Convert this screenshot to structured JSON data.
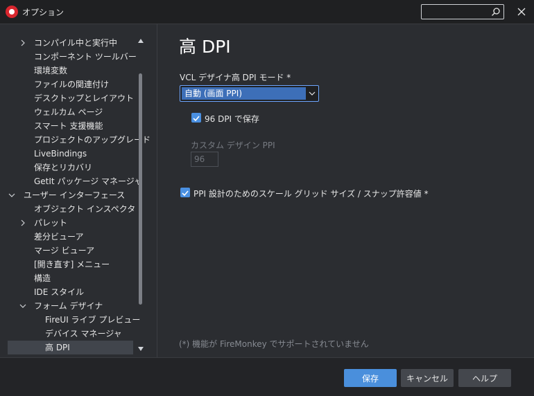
{
  "window": {
    "title": "オプション",
    "search_placeholder": ""
  },
  "sidebar": {
    "items": [
      {
        "label": "コンパイル中と実行中",
        "level": 1,
        "expander": "collapsed"
      },
      {
        "label": "コンポーネント ツールバー",
        "level": 1,
        "expander": "none"
      },
      {
        "label": "環境変数",
        "level": 1,
        "expander": "none"
      },
      {
        "label": "ファイルの関連付け",
        "level": 1,
        "expander": "none"
      },
      {
        "label": "デスクトップとレイアウト",
        "level": 1,
        "expander": "none"
      },
      {
        "label": "ウェルカム ページ",
        "level": 1,
        "expander": "none"
      },
      {
        "label": "スマート 支援機能",
        "level": 1,
        "expander": "none"
      },
      {
        "label": "プロジェクトのアップグレード",
        "level": 1,
        "expander": "none"
      },
      {
        "label": "LiveBindings",
        "level": 1,
        "expander": "none"
      },
      {
        "label": "保存とリカバリ",
        "level": 1,
        "expander": "none"
      },
      {
        "label": "GetIt パッケージ マネージャ",
        "level": 1,
        "expander": "none"
      },
      {
        "label": "ユーザー インターフェース",
        "level": 0,
        "expander": "expanded"
      },
      {
        "label": "オブジェクト インスペクタ",
        "level": 1,
        "expander": "none"
      },
      {
        "label": "パレット",
        "level": 1,
        "expander": "collapsed"
      },
      {
        "label": "差分ビューア",
        "level": 1,
        "expander": "none"
      },
      {
        "label": "マージ ビューア",
        "level": 1,
        "expander": "none"
      },
      {
        "label": "[開き直す] メニュー",
        "level": 1,
        "expander": "none"
      },
      {
        "label": "構造",
        "level": 1,
        "expander": "none"
      },
      {
        "label": "IDE スタイル",
        "level": 1,
        "expander": "none"
      },
      {
        "label": "フォーム デザイナ",
        "level": 1,
        "expander": "expanded"
      },
      {
        "label": "FireUI ライブ プレビュー",
        "level": 2,
        "expander": "none"
      },
      {
        "label": "デバイス マネージャ",
        "level": 2,
        "expander": "none"
      },
      {
        "label": "高 DPI",
        "level": 2,
        "expander": "none",
        "selected": true
      }
    ]
  },
  "main": {
    "title": "高 DPI",
    "mode_label": "VCL デザイナ高 DPI モード *",
    "mode_value": "自動 (画面 PPI)",
    "save96_label": "96 DPI で保存",
    "save96_checked": true,
    "custom_label": "カスタム デザイン PPI",
    "custom_value": "96",
    "scale_label": "PPI 設計のためのスケール グリッド サイズ / スナップ許容値 *",
    "scale_checked": true,
    "footnote": "(*) 機能が FireMonkey でサポートされていません"
  },
  "footer": {
    "save_label": "保存",
    "cancel_label": "キャンセル",
    "help_label": "ヘルプ"
  },
  "colors": {
    "accent": "#4a8fdc",
    "checkbox": "#4a90e2",
    "selection": "#3d6fb8",
    "background": "#2b2d31"
  }
}
